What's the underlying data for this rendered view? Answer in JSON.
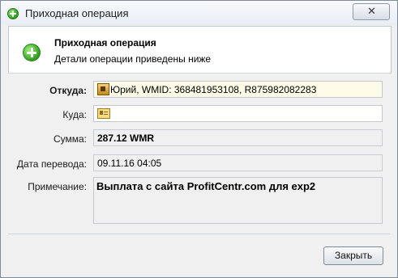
{
  "window": {
    "title": "Приходная операция",
    "close_glyph": "✕"
  },
  "header": {
    "title": "Приходная операция",
    "subtitle": "Детали операции приведены ниже"
  },
  "fields": {
    "from_label": "Откуда:",
    "from_value": "Юрий, WMID: 368481953108, R875982082283",
    "to_label": "Куда:",
    "to_value": "",
    "amount_label": "Сумма:",
    "amount_value": "287.12 WMR",
    "date_label": "Дата перевода:",
    "date_value": "09.11.16 04:05",
    "note_label": "Примечание:",
    "note_value": "Выплата с сайта ProfitCentr.com для exp2"
  },
  "buttons": {
    "close_label": "Закрыть"
  },
  "icons": {
    "title": "plus-circle-icon",
    "header": "plus-circle-icon",
    "from": "wallet-icon",
    "to": "contact-card-icon"
  }
}
